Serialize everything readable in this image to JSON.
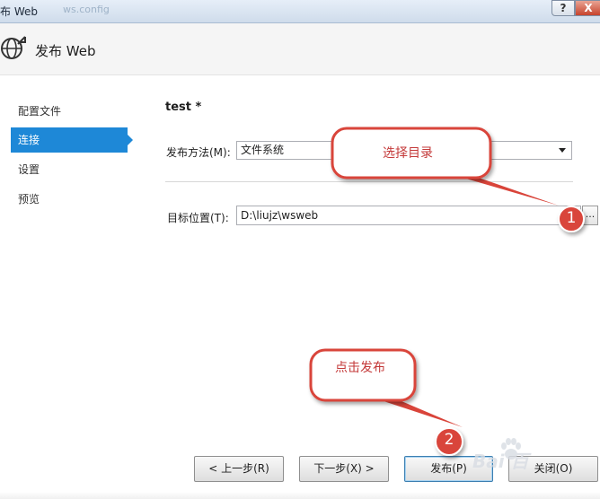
{
  "window": {
    "title": "布 Web",
    "faded_text": "ws.config",
    "help_label": "?",
    "close_label": "X"
  },
  "header": {
    "icon": "globe-arrow-icon",
    "title": "发布 Web"
  },
  "sidebar": {
    "items": [
      {
        "label": "配置文件",
        "active": false
      },
      {
        "label": "连接",
        "active": true
      },
      {
        "label": "设置",
        "active": false
      },
      {
        "label": "预览",
        "active": false
      }
    ]
  },
  "main": {
    "profile_name": "test *",
    "method_label": "发布方法(M):",
    "method_value": "文件系统",
    "target_label": "目标位置(T):",
    "target_value": "D:\\liujz\\wsweb",
    "browse_label": "..."
  },
  "buttons": {
    "prev": "< 上一步(R)",
    "next": "下一步(X) >",
    "publish": "发布(P)",
    "close": "关闭(O)"
  },
  "annotations": {
    "callout1": "选择目录",
    "callout2": "点击发布",
    "badge1": "1",
    "badge2": "2",
    "accent_color": "#d9443a"
  },
  "watermark": {
    "text": "Bai  百"
  },
  "colors": {
    "active_nav": "#1e88d7",
    "annotation_red": "#d9443a"
  }
}
